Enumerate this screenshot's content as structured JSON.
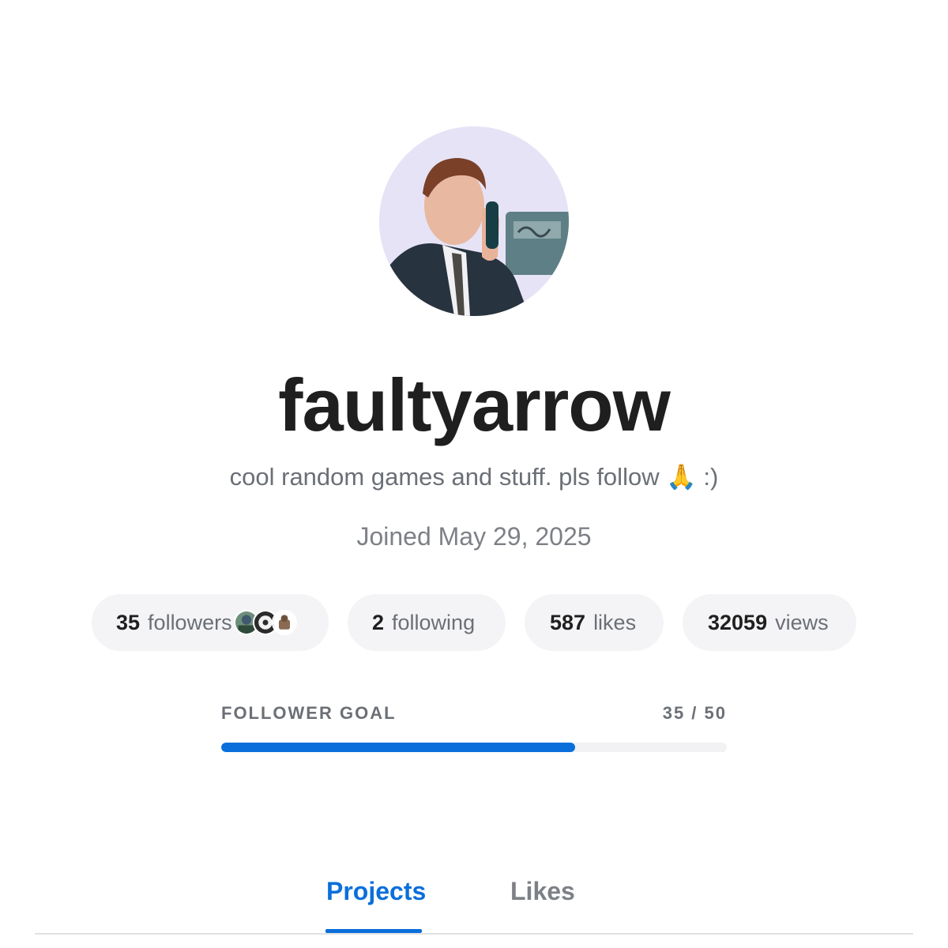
{
  "profile": {
    "username": "faultyarrow",
    "bio": "cool random games and stuff. pls follow 🙏 :)",
    "joined": "Joined May 29, 2025"
  },
  "stats": {
    "followers": {
      "count": "35",
      "label": "followers"
    },
    "following": {
      "count": "2",
      "label": "following"
    },
    "likes": {
      "count": "587",
      "label": "likes"
    },
    "views": {
      "count": "32059",
      "label": "views"
    }
  },
  "goal": {
    "label": "FOLLOWER GOAL",
    "value_text": "35 / 50",
    "current": 35,
    "target": 50
  },
  "tabs": [
    {
      "label": "Projects",
      "active": true
    },
    {
      "label": "Likes",
      "active": false
    }
  ],
  "colors": {
    "accent": "#0a6fdb",
    "muted_text": "#6b6f76",
    "pill_bg": "#f4f4f6"
  }
}
